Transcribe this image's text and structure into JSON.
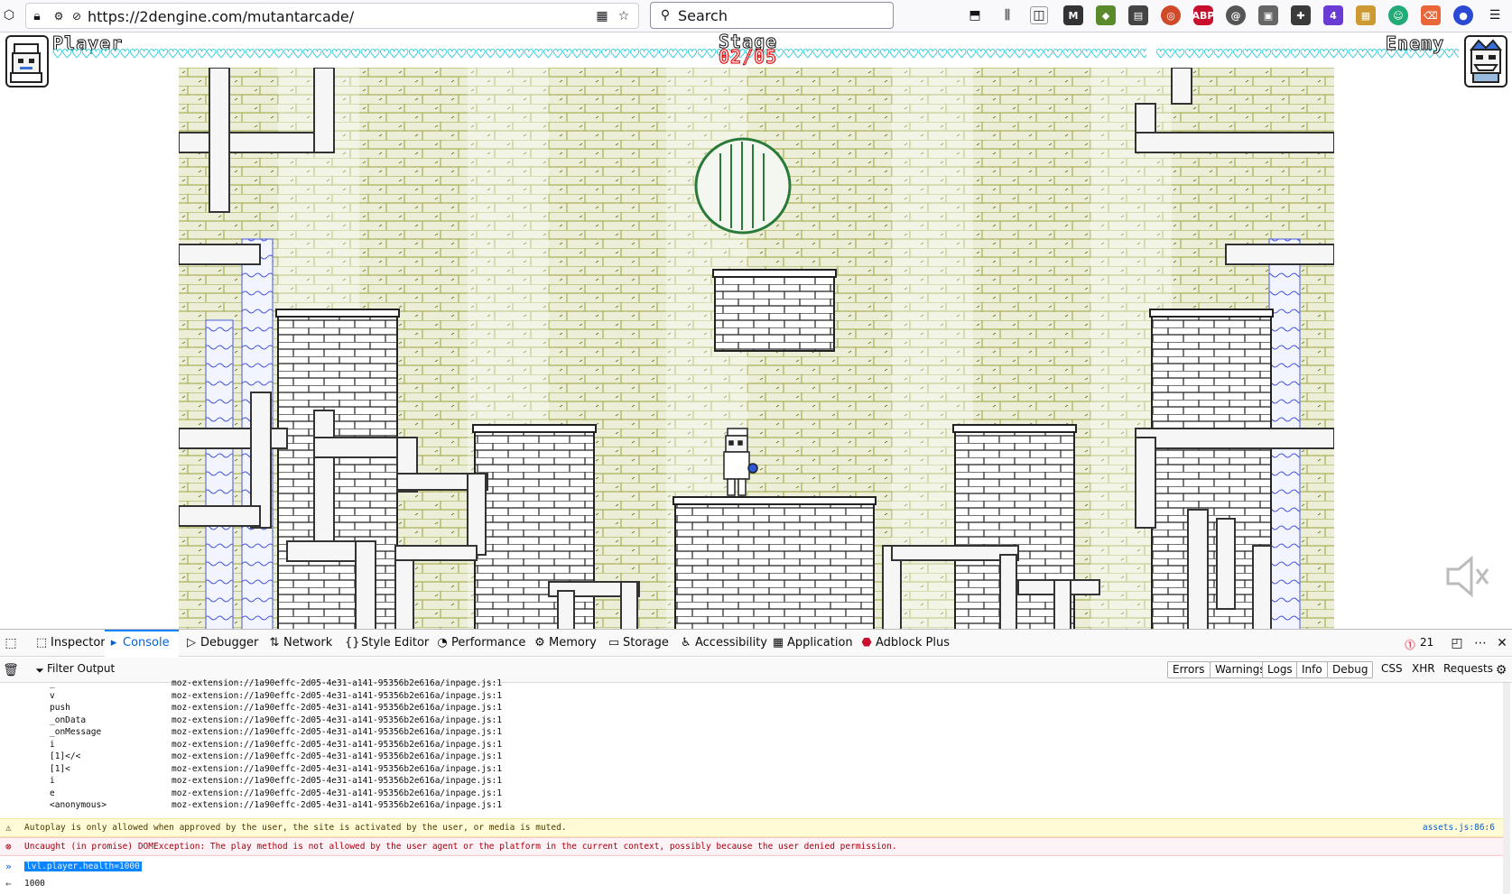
{
  "browser": {
    "url": "https://2dengine.com/mutantarcade/",
    "search_placeholder": "Search",
    "extension_badge": "4"
  },
  "game": {
    "player_label": "Player",
    "enemy_label": "Enemy",
    "stage_label": "Stage",
    "stage_value": "02/05"
  },
  "devtools": {
    "tabs": [
      {
        "label": "Inspector",
        "icon": "inspector-icon"
      },
      {
        "label": "Console",
        "icon": "console-icon"
      },
      {
        "label": "Debugger",
        "icon": "debugger-icon"
      },
      {
        "label": "Network",
        "icon": "network-icon"
      },
      {
        "label": "Style Editor",
        "icon": "style-editor-icon"
      },
      {
        "label": "Performance",
        "icon": "performance-icon"
      },
      {
        "label": "Memory",
        "icon": "memory-icon"
      },
      {
        "label": "Storage",
        "icon": "storage-icon"
      },
      {
        "label": "Accessibility",
        "icon": "accessibility-icon"
      },
      {
        "label": "Application",
        "icon": "application-icon"
      },
      {
        "label": "Adblock Plus",
        "icon": "adblock-icon"
      }
    ],
    "error_count": "21",
    "filter_placeholder": "Filter Output",
    "filters": [
      "Errors",
      "Warnings",
      "Logs",
      "Info",
      "Debug"
    ],
    "request_filters": [
      "CSS",
      "XHR",
      "Requests"
    ]
  },
  "console": {
    "stack": [
      {
        "fn": "_",
        "loc": "moz-extension://1a90effc-2d05-4e31-a141-95356b2e616a/inpage.js:1"
      },
      {
        "fn": "v",
        "loc": "moz-extension://1a90effc-2d05-4e31-a141-95356b2e616a/inpage.js:1"
      },
      {
        "fn": "push",
        "loc": "moz-extension://1a90effc-2d05-4e31-a141-95356b2e616a/inpage.js:1"
      },
      {
        "fn": "_onData",
        "loc": "moz-extension://1a90effc-2d05-4e31-a141-95356b2e616a/inpage.js:1"
      },
      {
        "fn": "_onMessage",
        "loc": "moz-extension://1a90effc-2d05-4e31-a141-95356b2e616a/inpage.js:1"
      },
      {
        "fn": "i",
        "loc": "moz-extension://1a90effc-2d05-4e31-a141-95356b2e616a/inpage.js:1"
      },
      {
        "fn": "[1]</<",
        "loc": "moz-extension://1a90effc-2d05-4e31-a141-95356b2e616a/inpage.js:1"
      },
      {
        "fn": "[1]<",
        "loc": "moz-extension://1a90effc-2d05-4e31-a141-95356b2e616a/inpage.js:1"
      },
      {
        "fn": "i",
        "loc": "moz-extension://1a90effc-2d05-4e31-a141-95356b2e616a/inpage.js:1"
      },
      {
        "fn": "e",
        "loc": "moz-extension://1a90effc-2d05-4e31-a141-95356b2e616a/inpage.js:1"
      },
      {
        "fn": "<anonymous>",
        "loc": "moz-extension://1a90effc-2d05-4e31-a141-95356b2e616a/inpage.js:1"
      }
    ],
    "warning": "Autoplay is only allowed when approved by the user, the site is activated by the user, or media is muted.",
    "warning_location": "assets.js:86:6",
    "error": "Uncaught (in promise) DOMException: The play method is not allowed by the user agent or the platform in the current context, possibly because the user denied permission.",
    "input": "lvl.player.health=1000",
    "result": "1000"
  },
  "colors": {
    "accent": "#0a84ff",
    "hearts": "#19c8d8",
    "stage_red": "#d00000",
    "brick_bg": "#e9ecd4",
    "brick_line": "#9aa33a"
  }
}
